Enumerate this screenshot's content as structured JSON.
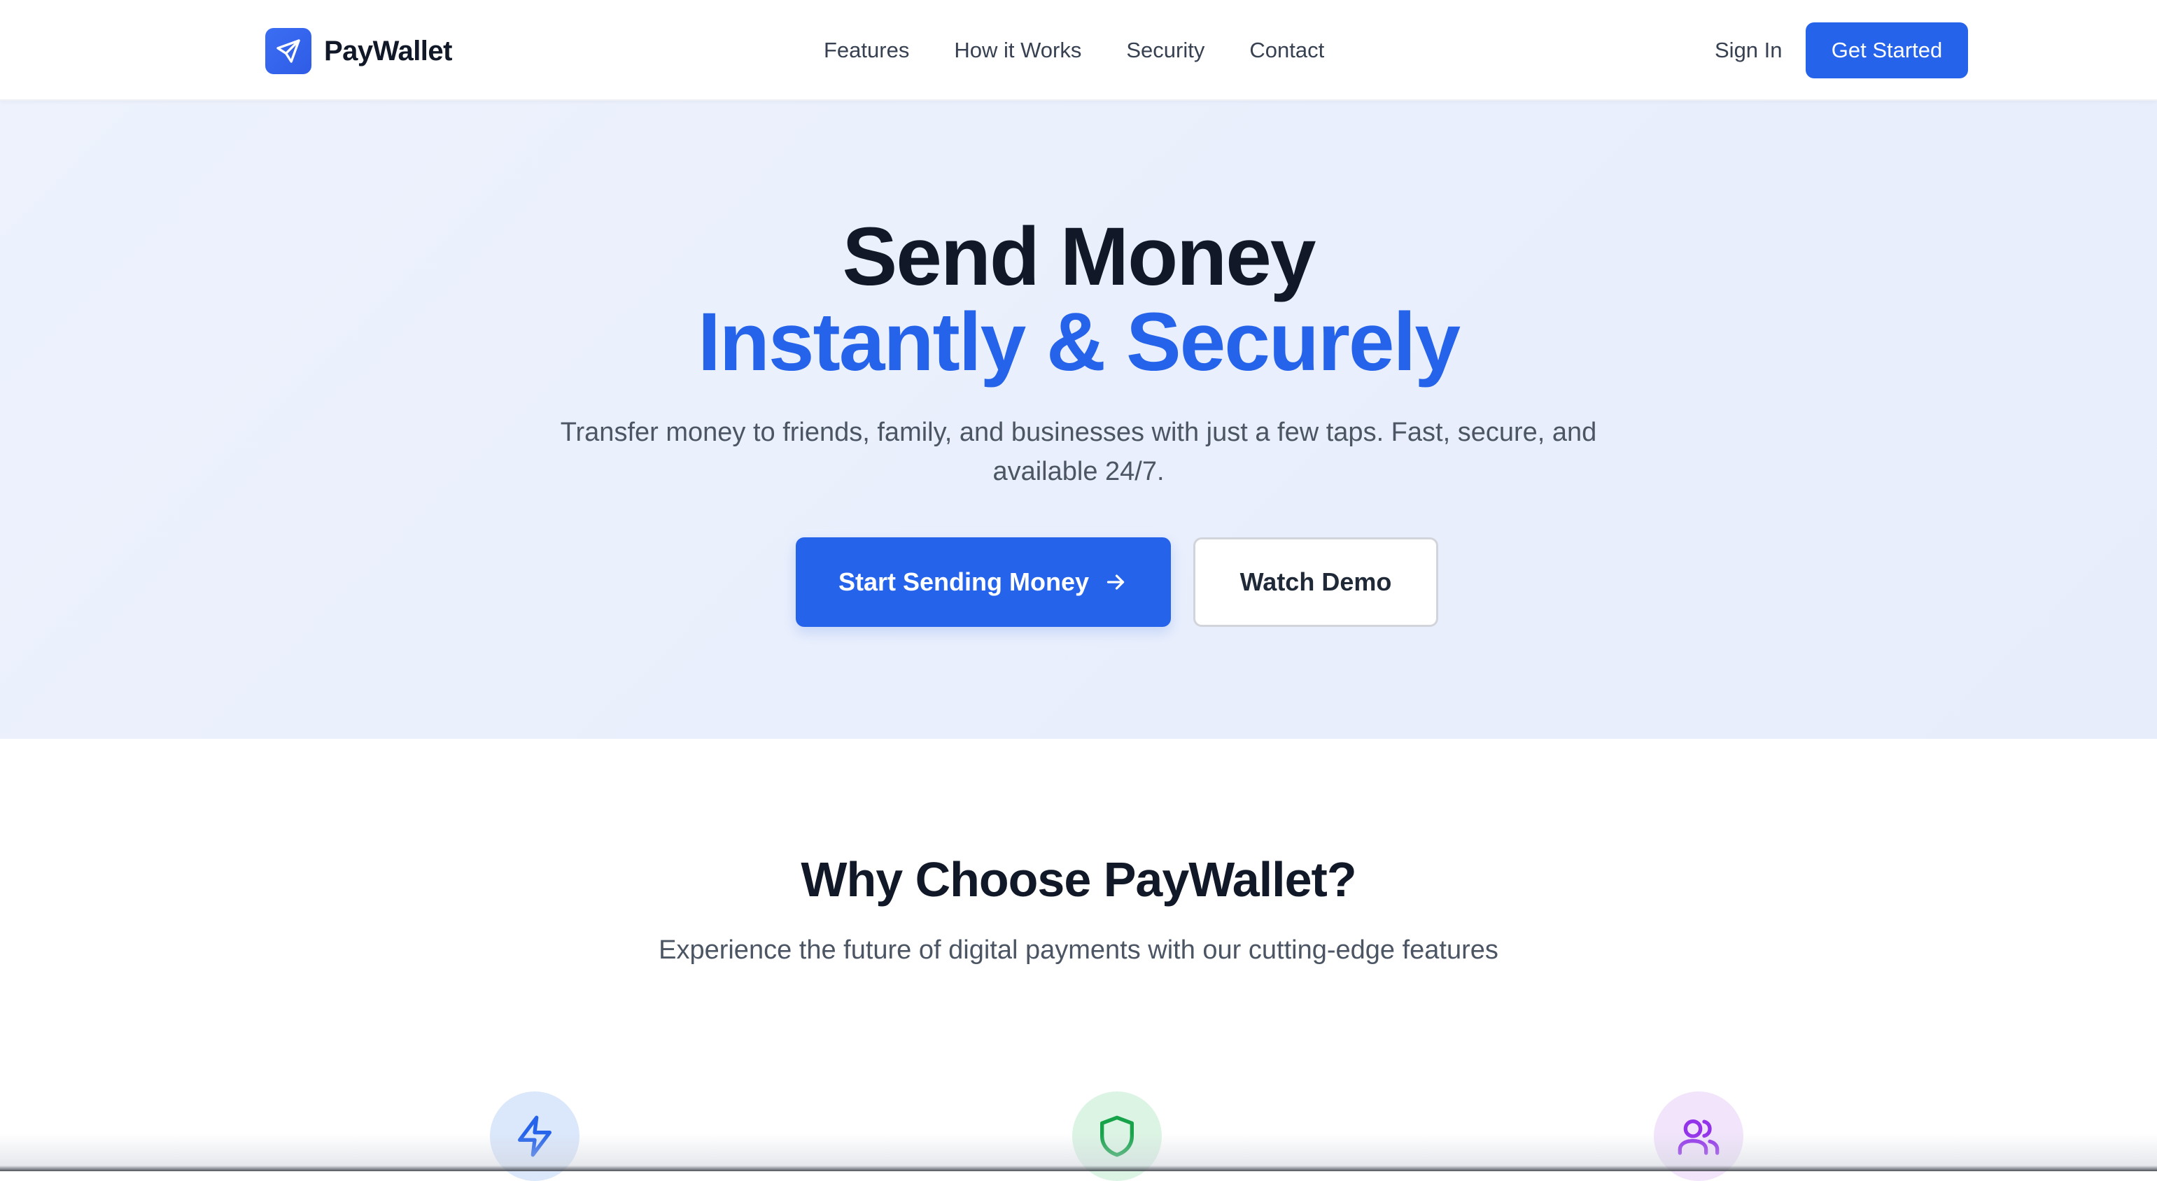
{
  "brand": {
    "name": "PayWallet",
    "logo_icon": "send-icon",
    "accent_color": "#2563eb"
  },
  "nav": {
    "items": [
      {
        "label": "Features"
      },
      {
        "label": "How it Works"
      },
      {
        "label": "Security"
      },
      {
        "label": "Contact"
      }
    ],
    "sign_in": "Sign In",
    "get_started": "Get Started"
  },
  "hero": {
    "title_line_1": "Send Money",
    "title_line_2": "Instantly & Securely",
    "subtitle": "Transfer money to friends, family, and businesses with just a few taps. Fast, secure, and available 24/7.",
    "primary_cta": "Start Sending Money",
    "primary_cta_icon": "arrow-right-icon",
    "secondary_cta": "Watch Demo"
  },
  "features": {
    "title": "Why Choose PayWallet?",
    "subtitle": "Experience the future of digital payments with our cutting-edge features",
    "icons": [
      {
        "icon": "lightning-icon",
        "color": "#2563eb"
      },
      {
        "icon": "shield-icon",
        "color": "#16a34a"
      },
      {
        "icon": "users-icon",
        "color": "#9333ea"
      }
    ]
  }
}
